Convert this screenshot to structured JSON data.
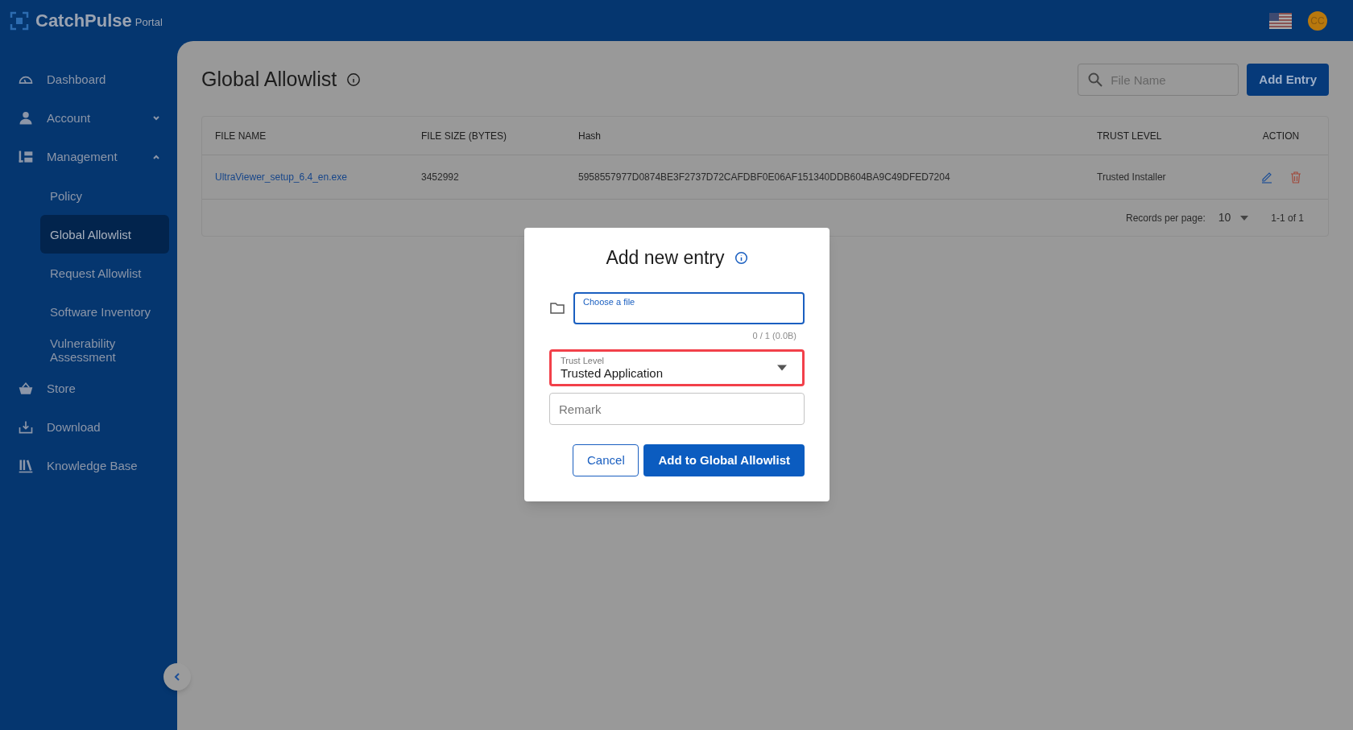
{
  "brand": {
    "name": "CatchPulse",
    "suffix": "Portal"
  },
  "header": {
    "avatar": "CC"
  },
  "sidebar": {
    "items": [
      {
        "kind": "dashboard",
        "label": "Dashboard",
        "selected": false
      },
      {
        "kind": "account",
        "label": "Account",
        "selected": false,
        "expanded": false
      },
      {
        "kind": "management",
        "label": "Management",
        "selected": false,
        "expanded": true,
        "children": [
          {
            "label": "Policy",
            "selected": false
          },
          {
            "label": "Global Allowlist",
            "selected": true
          },
          {
            "label": "Request Allowlist",
            "selected": false
          },
          {
            "label": "Software Inventory",
            "selected": false
          },
          {
            "label": "Vulnerability Assessment",
            "selected": false
          }
        ]
      },
      {
        "kind": "store",
        "label": "Store",
        "selected": false
      },
      {
        "kind": "download",
        "label": "Download",
        "selected": false
      },
      {
        "kind": "knowledge",
        "label": "Knowledge Base",
        "selected": false
      }
    ]
  },
  "page": {
    "title": "Global Allowlist",
    "search": {
      "placeholder": "File Name"
    },
    "add_button": "Add Entry"
  },
  "table": {
    "columns": [
      "FILE NAME",
      "FILE SIZE (BYTES)",
      "Hash",
      "TRUST LEVEL",
      "ACTION"
    ],
    "rows": [
      {
        "file_name": "UltraViewer_setup_6.4_en.exe",
        "file_size": "3452992",
        "hash": "5958557977D0874BE3F2737D72CAFDBF0E06AF151340DDB604BA9C49DFED7204",
        "trust_level": "Trusted Installer"
      }
    ],
    "footer": {
      "records_label": "Records per page:",
      "per_page": "10",
      "range": "1-1 of 1"
    }
  },
  "dialog": {
    "title": "Add new entry",
    "file_field": {
      "label": "Choose a file",
      "counter": "0 / 1 (0.0B)"
    },
    "trust_level": {
      "label": "Trust Level",
      "value": "Trusted Application",
      "highlighted": true
    },
    "remark": {
      "placeholder": "Remark"
    },
    "cancel": "Cancel",
    "submit": "Add to Global Allowlist"
  }
}
